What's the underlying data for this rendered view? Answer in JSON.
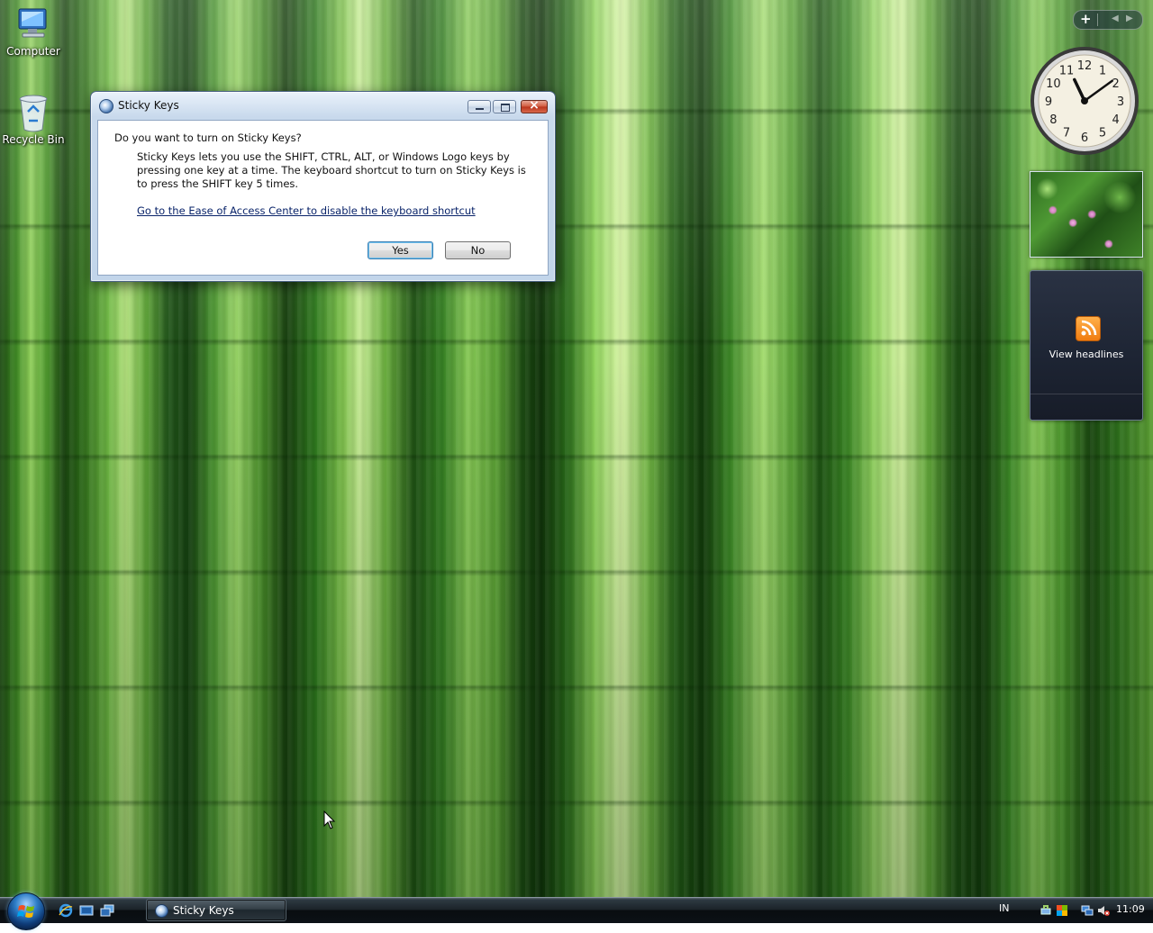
{
  "desktop_icons": [
    {
      "label": "Computer",
      "icon": "computer-icon"
    },
    {
      "label": "Recycle Bin",
      "icon": "recycle-bin-icon"
    }
  ],
  "dialog": {
    "title": "Sticky Keys",
    "question": "Do you want to turn on Sticky Keys?",
    "description": "Sticky Keys lets you use the SHIFT, CTRL, ALT, or Windows Logo keys by pressing one key at a time. The keyboard shortcut to turn on Sticky Keys is to press the SHIFT key 5 times.",
    "link": "Go to the Ease of Access Center to disable the keyboard shortcut",
    "yes_label": "Yes",
    "no_label": "No",
    "close_glyph": "×"
  },
  "sidebar": {
    "add_glyph": "+",
    "clock": {
      "hour": 11,
      "minute": 9
    },
    "feed_label": "View headlines"
  },
  "taskbar": {
    "task_title": "Sticky Keys",
    "language": "IN",
    "time": "11:09"
  },
  "colors": {
    "link": "#0a246a",
    "taskbar": "#0c1116",
    "accent": "#3c7fb1"
  }
}
